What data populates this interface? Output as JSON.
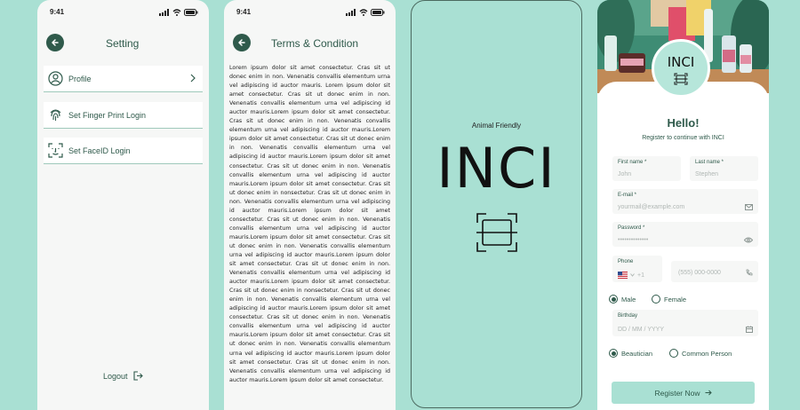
{
  "settings_screen": {
    "time": "9:41",
    "title": "Setting",
    "items": [
      {
        "label": "Profile",
        "icon": "user-icon"
      },
      {
        "label": "Set Finger Print Login",
        "icon": "fingerprint-icon"
      },
      {
        "label": "Set FaceID Login",
        "icon": "faceid-icon"
      }
    ],
    "logout_label": "Logout"
  },
  "terms_screen": {
    "time": "9:41",
    "title": "Terms & Condition",
    "body": "Lorem ipsum dolor sit amet consectetur. Cras sit ut donec enim in non. Venenatis convallis elementum urna vel adipiscing id auctor mauris. Lorem ipsum dolor sit amet consectetur. Cras sit ut donec enim in non. Venenatis convallis elementum urna vel adipiscing id auctor mauris.Lorem ipsum dolor sit amet consectetur. Cras sit ut donec enim in non. Venenatis convallis elementum urna vel adipiscing id auctor mauris.Lorem ipsum dolor sit amet consectetur. Cras sit ut donec enim in non. Venenatis convallis elementum urna vel adipiscing id auctor mauris.Lorem ipsum dolor sit amet consectetur. Cras sit ut donec enim in non. Venenatis convallis elementum urna vel adipiscing id auctor mauris.Lorem ipsum dolor sit amet consectetur. Cras sit ut donec enim in nonsectetur. Cras sit ut donec enim in non. Venenatis convallis elementum urna vel adipiscing id auctor mauris.Lorem ipsum dolor sit amet consectetur. Cras sit ut donec enim in non. Venenatis convallis elementum urna vel adipiscing id auctor mauris.Lorem ipsum dolor sit amet consectetur. Cras sit ut donec enim in non. Venenatis convallis elementum urna vel adipiscing id auctor mauris.Lorem ipsum dolor sit amet consectetur. Cras sit ut donec enim in non. Venenatis convallis elementum urna vel adipiscing id auctor mauris.Lorem ipsum dolor sit amet consectetur. Cras sit ut donec enim in nonsectetur. Cras sit ut donec enim in non. Venenatis convallis elementum urna vel adipiscing id auctor mauris.Lorem ipsum dolor sit amet consectetur. Cras sit ut donec enim in non. Venenatis convallis elementum urna vel adipiscing id auctor mauris.Lorem ipsum dolor sit amet consectetur. Cras sit ut donec enim in non. Venenatis convallis elementum urna vel adipiscing id auctor mauris.Lorem ipsum dolor sit amet consectetur. Cras sit ut donec enim in non. Venenatis convallis elementum urna vel adipiscing id auctor mauris.Lorem ipsum dolor sit amet consectetur."
  },
  "splash_screen": {
    "subtitle": "Animal Friendly",
    "logo_text": "INCI"
  },
  "register_screen": {
    "logo_text": "INCI",
    "greeting": "Hello!",
    "subtitle": "Register to continue with INCI",
    "first_name": {
      "label": "First name *",
      "placeholder": "John"
    },
    "last_name": {
      "label": "Last name *",
      "placeholder": "Stephen"
    },
    "email": {
      "label": "E-mail *",
      "placeholder": "yourmail@example.com"
    },
    "password": {
      "label": "Password *",
      "placeholder": "••••••••••••••"
    },
    "phone": {
      "label": "Phone",
      "country_code": "+1",
      "placeholder": "(555) 000-0000"
    },
    "gender_options": [
      "Male",
      "Female"
    ],
    "gender_selected": "Male",
    "birthday": {
      "label": "Birthday",
      "placeholder": "DD / MM / YYYY"
    },
    "role_options": [
      "Beautician",
      "Common Person"
    ],
    "role_selected": "Beautician",
    "register_label": "Register Now"
  },
  "colors": {
    "background": "#a9e0d3",
    "primary": "#2f5a4b",
    "button": "#a9e0d3",
    "field_bg": "#f6f7f6"
  }
}
